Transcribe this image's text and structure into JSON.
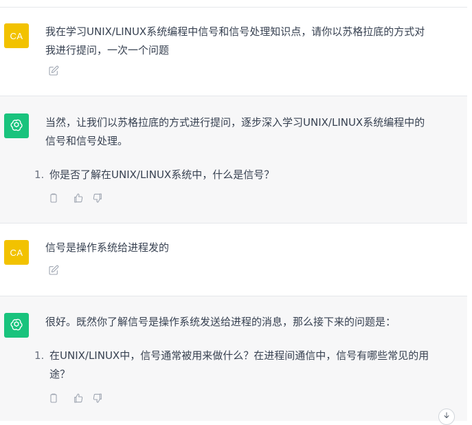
{
  "conversation": [
    {
      "role": "user",
      "avatar_text": "CA",
      "paragraphs": [
        "我在学习UNIX/LINUX系统编程中信号和信号处理知识点，请你以苏格拉底的方式对",
        "我进行提问，一次一个问题"
      ]
    },
    {
      "role": "assistant",
      "paragraphs": [
        "当然，让我们以苏格拉底的方式进行提问，逐步深入学习UNIX/LINUX系统编程中的",
        "信号和信号处理。"
      ],
      "list": [
        {
          "num": "1.",
          "lines": [
            "你是否了解在UNIX/LINUX系统中，什么是信号？"
          ]
        }
      ]
    },
    {
      "role": "user",
      "avatar_text": "CA",
      "paragraphs": [
        "信号是操作系统给进程发的"
      ]
    },
    {
      "role": "assistant",
      "paragraphs": [
        "很好。既然你了解信号是操作系统发送给进程的消息，那么接下来的问题是："
      ],
      "list": [
        {
          "num": "1.",
          "lines": [
            "在UNIX/LINUX中，信号通常被用来做什么？在进程间通信中，信号有哪些常见的用",
            "途？"
          ]
        }
      ]
    }
  ],
  "icons": {
    "user_action": "edit-icon",
    "assistant_actions": [
      "copy-icon",
      "thumbs-up-icon",
      "thumbs-down-icon"
    ],
    "scroll": "arrow-down-icon"
  },
  "colors": {
    "user_avatar": "#f2c200",
    "assistant_avatar": "#19c37d",
    "assistant_bg": "#f7f7f8",
    "text": "#374151",
    "icon": "#9ca3af"
  }
}
